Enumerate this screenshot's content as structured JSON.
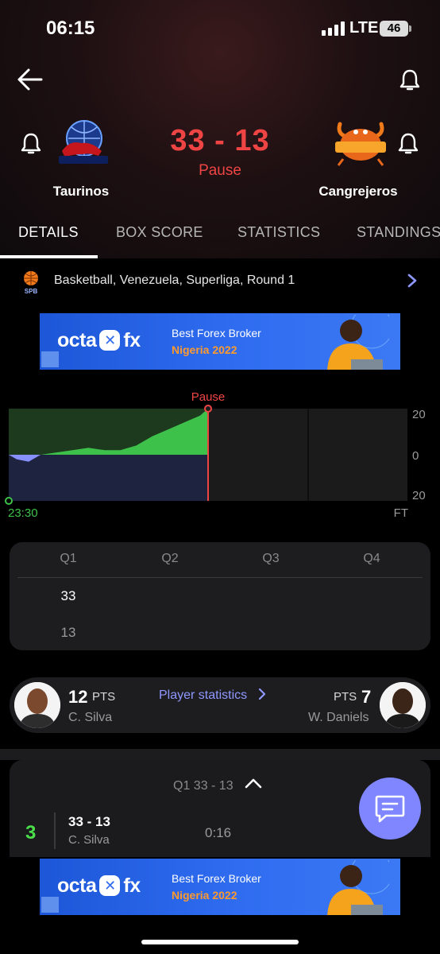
{
  "status_bar": {
    "time": "06:15",
    "network": "LTE",
    "battery": "46"
  },
  "match": {
    "home": {
      "name": "Taurinos",
      "logo_text": "TAURINOS"
    },
    "away": {
      "name": "Cangrejeros",
      "logo_text": "CANGREJEROS"
    },
    "score": "33 - 13",
    "status": "Pause"
  },
  "tabs": [
    {
      "label": "DETAILS",
      "active": true
    },
    {
      "label": "BOX SCORE",
      "active": false
    },
    {
      "label": "STATISTICS",
      "active": false
    },
    {
      "label": "STANDINGS",
      "active": false
    }
  ],
  "league": {
    "logo_text": "SPB",
    "text": "Basketball, Venezuela, Superliga, Round 1"
  },
  "ads": [
    {
      "brand_left": "octa",
      "brand_mark": "✕",
      "brand_right": "fx",
      "line1": "Best Forex Broker",
      "line2": "Nigeria 2022"
    },
    {
      "brand_left": "octa",
      "brand_mark": "✕",
      "brand_right": "fx",
      "line1": "Best Forex Broker",
      "line2": "Nigeria 2022"
    }
  ],
  "chart_data": {
    "type": "area",
    "marker_label": "Pause",
    "start_label": "23:30",
    "end_label": "FT",
    "y_ticks": [
      "20",
      "0",
      "20"
    ],
    "ylim": [
      -20,
      20
    ],
    "x_fraction_of_game": [
      0,
      0.02,
      0.05,
      0.08,
      0.12,
      0.16,
      0.2,
      0.24,
      0.28,
      0.32,
      0.36,
      0.4,
      0.44,
      0.48,
      0.5
    ],
    "lead": [
      0,
      -2,
      -3,
      0,
      1,
      2,
      3,
      2,
      2,
      4,
      8,
      11,
      14,
      17,
      20
    ],
    "colors": {
      "home": "#3ec14b",
      "away": "#8690ff",
      "marker": "#ef4444"
    }
  },
  "quarters": {
    "headers": [
      "Q1",
      "Q2",
      "Q3",
      "Q4"
    ],
    "home": [
      "33",
      "",
      "",
      ""
    ],
    "away": [
      "13",
      "",
      "",
      ""
    ]
  },
  "players": {
    "link_label": "Player statistics",
    "home": {
      "pts": "12",
      "pts_label": "PTS",
      "name": "C. Silva"
    },
    "away": {
      "pts": "7",
      "pts_label": "PTS",
      "name": "W. Daniels"
    }
  },
  "events": {
    "header": "Q1 33 - 13",
    "items": [
      {
        "points": "3",
        "score": "33 - 13",
        "player": "C. Silva",
        "time": "0:16"
      }
    ]
  },
  "colors": {
    "accent": "#ef4444",
    "fab": "#7f86ff",
    "link": "#8f98ff"
  }
}
